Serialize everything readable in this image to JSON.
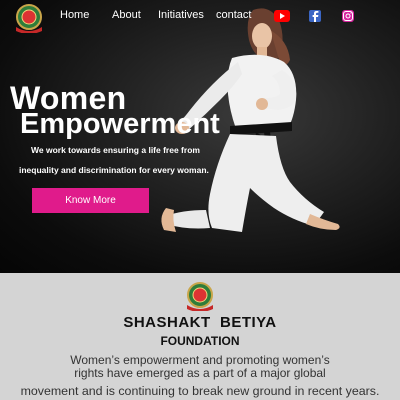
{
  "nav": {
    "links": [
      "Home",
      "About",
      "Initiatives",
      "contact"
    ],
    "social_icons": [
      "youtube-icon",
      "facebook-icon",
      "instagram-icon"
    ]
  },
  "hero": {
    "title_line1": "Women",
    "title_line2": "Empowerment",
    "subtitle_line1": "We work towards ensuring a life free from",
    "subtitle_line2": "inequality and discrimination for every woman.",
    "cta_label": "Know More"
  },
  "foundation": {
    "name": "SHASHAKT  BETIYA",
    "sub": "FOUNDATION",
    "para_line1": "Women’s empowerment and promoting women’s",
    "para_line2": "rights have emerged as a part of a major global",
    "para_line3": "movement and is continuing to break new ground in recent years."
  },
  "colors": {
    "accent": "#e01b8b",
    "section_bg": "#d4d4d4",
    "hero_bg": "#111111"
  }
}
